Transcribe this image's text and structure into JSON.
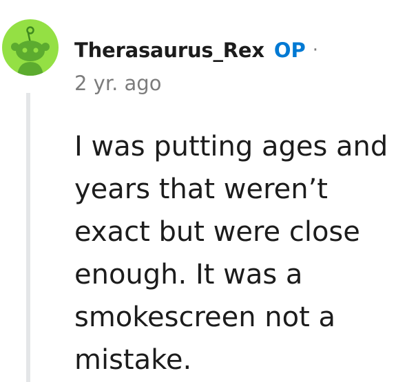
{
  "comment": {
    "author": "Therasaurus_Rex",
    "op_badge": "OP",
    "separator": "·",
    "timestamp": "2 yr. ago",
    "body_lines": [
      "I was putting ages and",
      "years that weren’t",
      "exact but were close",
      "enough. It was a",
      "smokescreen not a",
      "mistake."
    ],
    "avatar_icon": "snoo-avatar-icon"
  },
  "colors": {
    "avatar_background": "#94e044",
    "op_badge": "#0079d3",
    "meta_text": "#7c7c7c",
    "body_text": "#1c1c1c",
    "thread_line": "#e4e6e8"
  }
}
